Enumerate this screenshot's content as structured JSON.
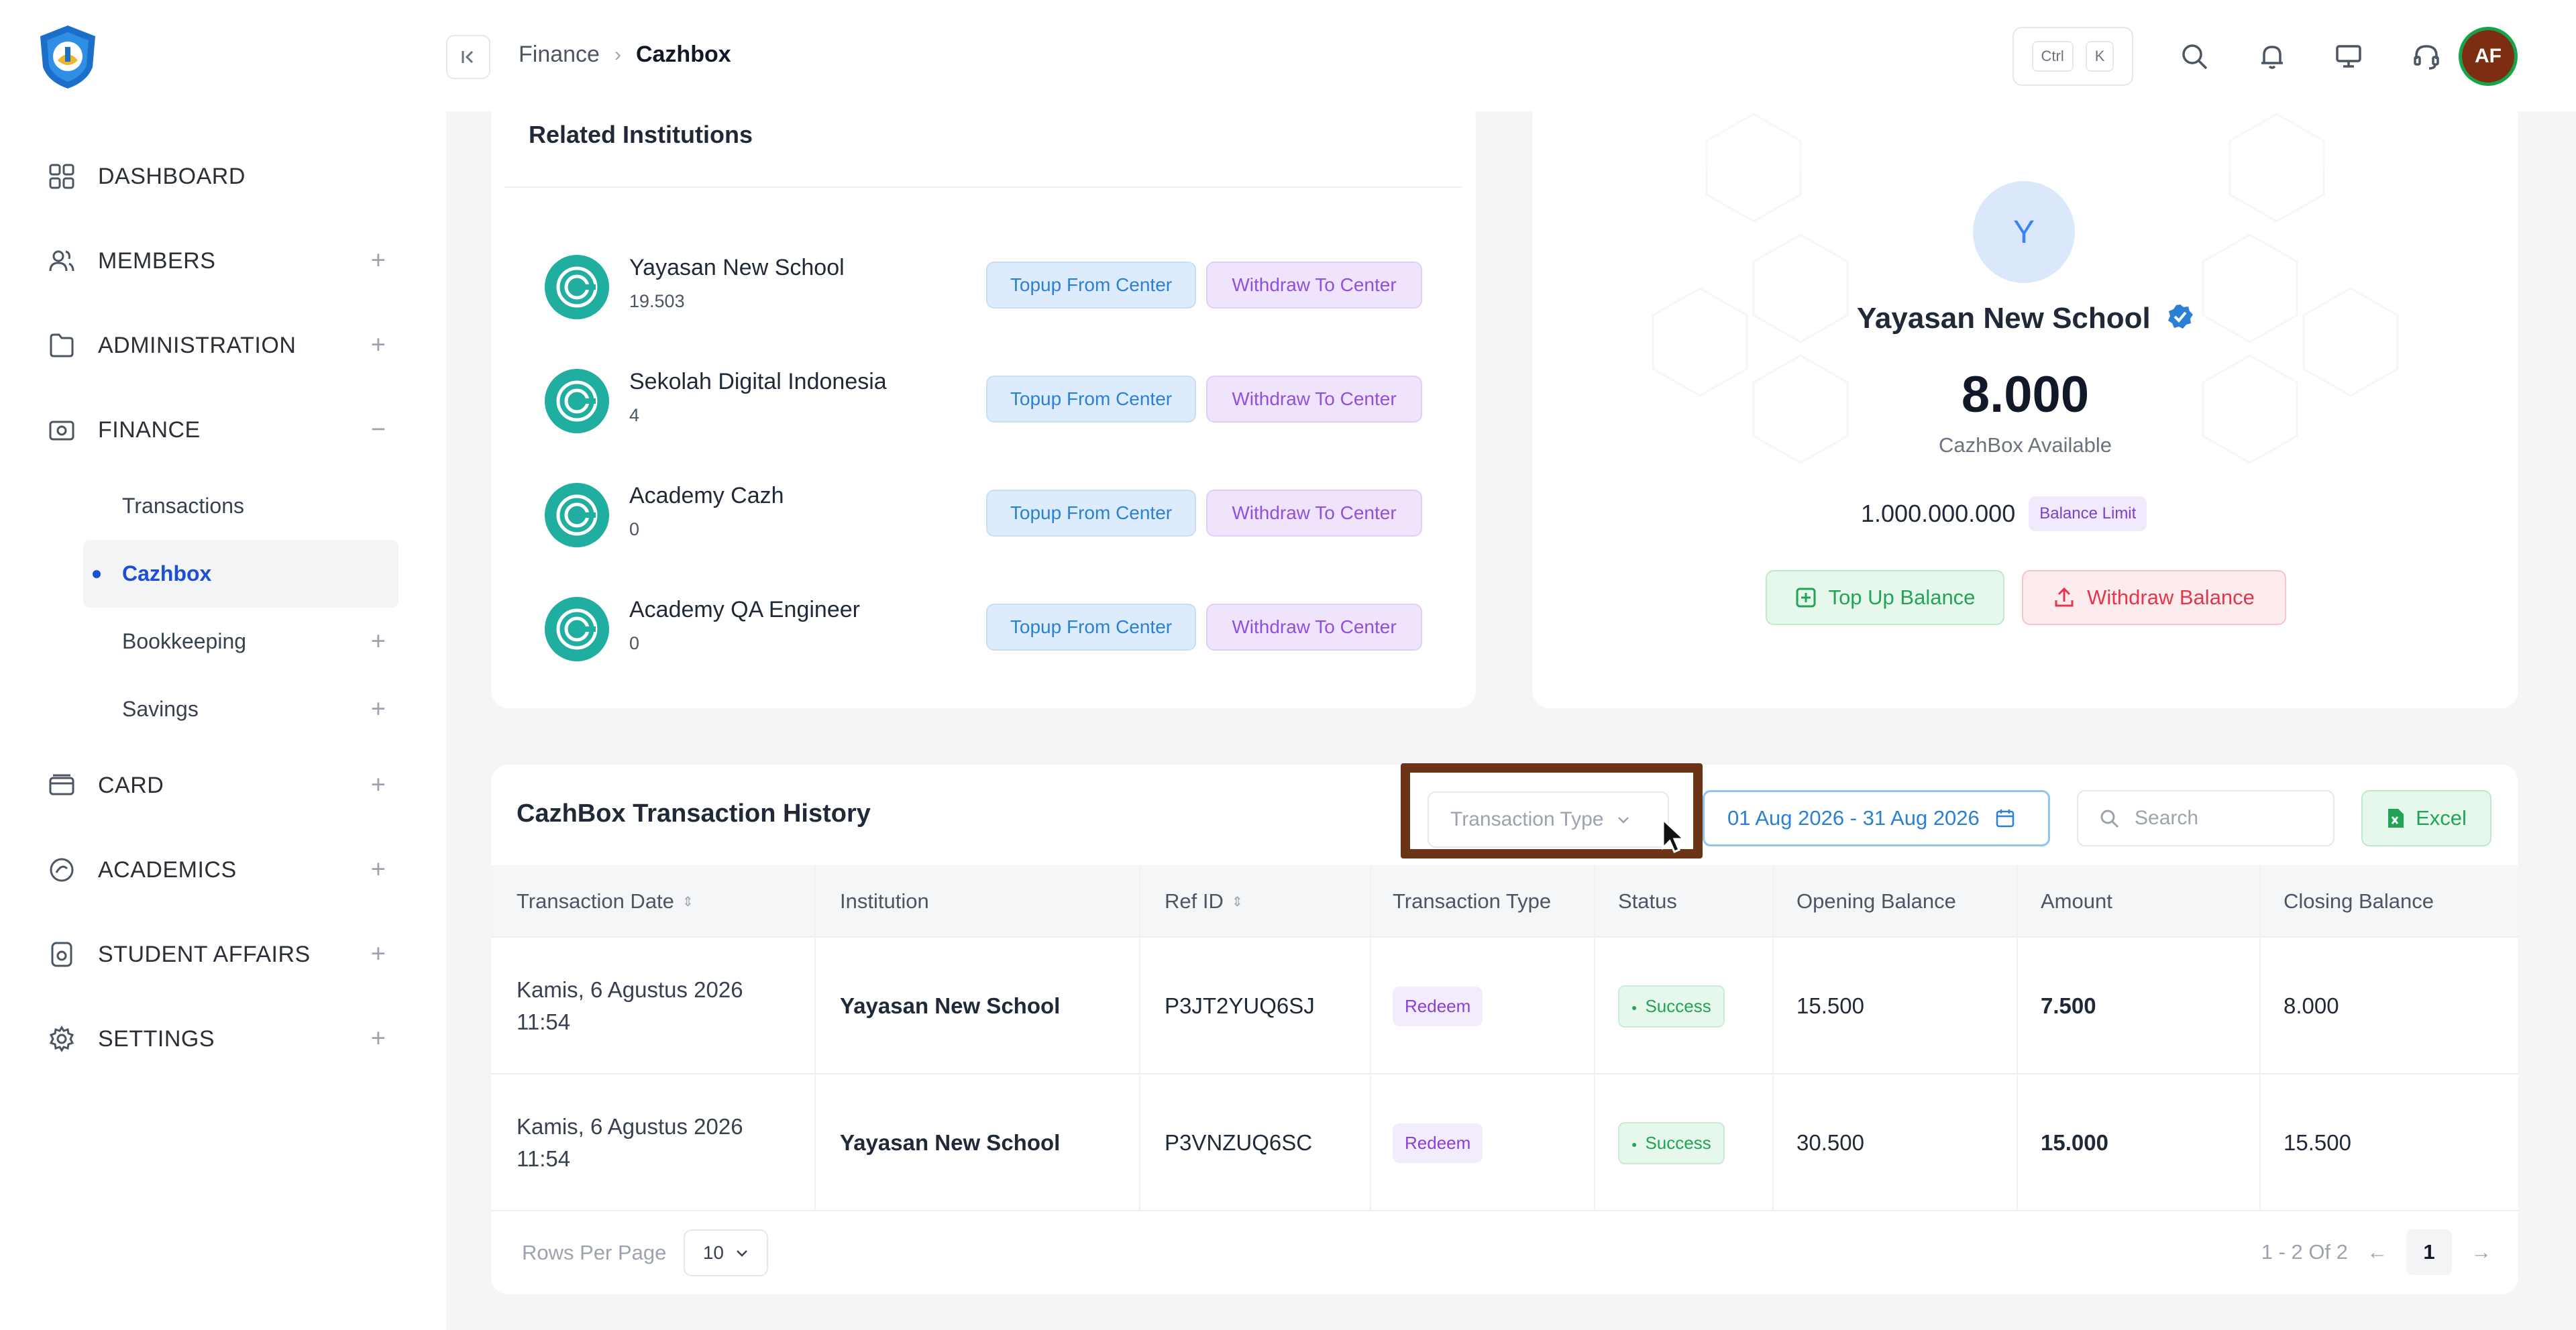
{
  "header": {
    "breadcrumb": [
      "Finance",
      "Cazhbox"
    ],
    "kbd": [
      "Ctrl",
      "K"
    ],
    "avatar_initials": "AF"
  },
  "sidebar": {
    "items": [
      {
        "label": "DASHBOARD",
        "icon": "dashboard-grid-icon",
        "toggle": ""
      },
      {
        "label": "MEMBERS",
        "icon": "users-icon",
        "toggle": "+"
      },
      {
        "label": "ADMINISTRATION",
        "icon": "folder-icon",
        "toggle": "+"
      },
      {
        "label": "FINANCE",
        "icon": "wallet-icon",
        "toggle": "−"
      },
      {
        "label": "CARD",
        "icon": "card-icon",
        "toggle": "+"
      },
      {
        "label": "ACADEMICS",
        "icon": "academics-icon",
        "toggle": "+"
      },
      {
        "label": "STUDENT AFFAIRS",
        "icon": "student-affairs-icon",
        "toggle": "+"
      },
      {
        "label": "SETTINGS",
        "icon": "settings-icon",
        "toggle": "+"
      }
    ],
    "finance_sub": [
      {
        "label": "Transactions",
        "toggle": ""
      },
      {
        "label": "Cazhbox",
        "toggle": "",
        "active": true
      },
      {
        "label": "Bookkeeping",
        "toggle": "+"
      },
      {
        "label": "Savings",
        "toggle": "+"
      }
    ]
  },
  "related": {
    "title": "Related Institutions",
    "topup_label": "Topup From Center",
    "withdraw_label": "Withdraw To Center",
    "institutions": [
      {
        "name": "Yayasan New School",
        "value": "19.503"
      },
      {
        "name": "Sekolah Digital Indonesia",
        "value": "4"
      },
      {
        "name": "Academy Cazh",
        "value": "0"
      },
      {
        "name": "Academy QA Engineer",
        "value": "0"
      }
    ]
  },
  "profile": {
    "initial": "Y",
    "name": "Yayasan New School",
    "amount": "8.000",
    "amount_label": "CazhBox Available",
    "limit_value": "1.000.000.000",
    "limit_badge": "Balance Limit",
    "topup_button": "Top Up Balance",
    "withdraw_button": "Withdraw Balance"
  },
  "history": {
    "title": "CazhBox Transaction History",
    "type_placeholder": "Transaction Type",
    "date_range": "01 Aug 2026 - 31 Aug 2026",
    "search_placeholder": "Search",
    "excel_label": "Excel",
    "columns": [
      "Transaction Date",
      "Institution",
      "Ref ID",
      "Transaction Type",
      "Status",
      "Opening Balance",
      "Amount",
      "Closing Balance"
    ],
    "rows": [
      {
        "date_line1": "Kamis, 6 Agustus 2026",
        "date_line2": "11:54",
        "institution": "Yayasan New School",
        "ref": "P3JT2YUQ6SJ",
        "type": "Redeem",
        "status": "Success",
        "opening": "15.500",
        "amount": "7.500",
        "closing": "8.000"
      },
      {
        "date_line1": "Kamis, 6 Agustus 2026",
        "date_line2": "11:54",
        "institution": "Yayasan New School",
        "ref": "P3VNZUQ6SC",
        "type": "Redeem",
        "status": "Success",
        "opening": "30.500",
        "amount": "15.000",
        "closing": "15.500"
      }
    ],
    "rows_per_page_label": "Rows Per Page",
    "rows_per_page": "10",
    "range_text": "1 - 2 Of 2",
    "current_page": "1"
  },
  "colors": {
    "accent": "#1d4ed8",
    "highlight_box": "#6b3417",
    "success": "#22a356",
    "danger": "#e3364c",
    "purple": "#8a3fd9"
  }
}
